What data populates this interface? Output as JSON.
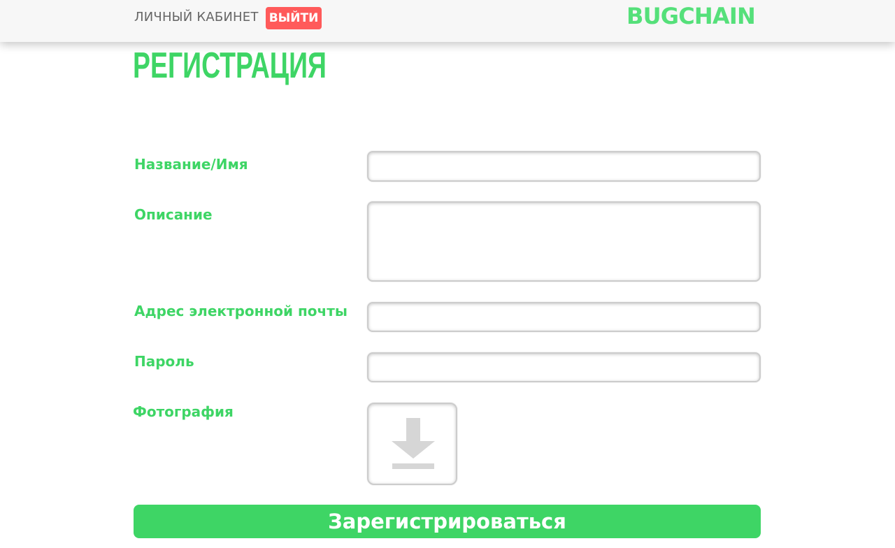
{
  "header": {
    "cabinet_label": "ЛИЧНЫЙ КАБИНЕТ",
    "logout_label": "ВЫЙТИ",
    "logo_text": "BUGCHAIN"
  },
  "page": {
    "title": "РЕГИСТРАЦИЯ"
  },
  "form": {
    "name_label": "Название/Имя",
    "name_value": "",
    "description_label": "Описание",
    "description_value": "",
    "email_label": "Адрес электронной почты",
    "email_value": "",
    "password_label": "Пароль",
    "password_value": "",
    "photo_label": "Фотография",
    "photo_icon": "download-icon",
    "submit_label": "Зарегистрироваться"
  },
  "colors": {
    "accent_green": "#3ed565",
    "logo_green": "#55e07a",
    "logout_red": "#ff5a5a",
    "header_bg": "#f7f7f7",
    "nav_text": "#666666",
    "icon_gray": "#d6d6d6"
  }
}
